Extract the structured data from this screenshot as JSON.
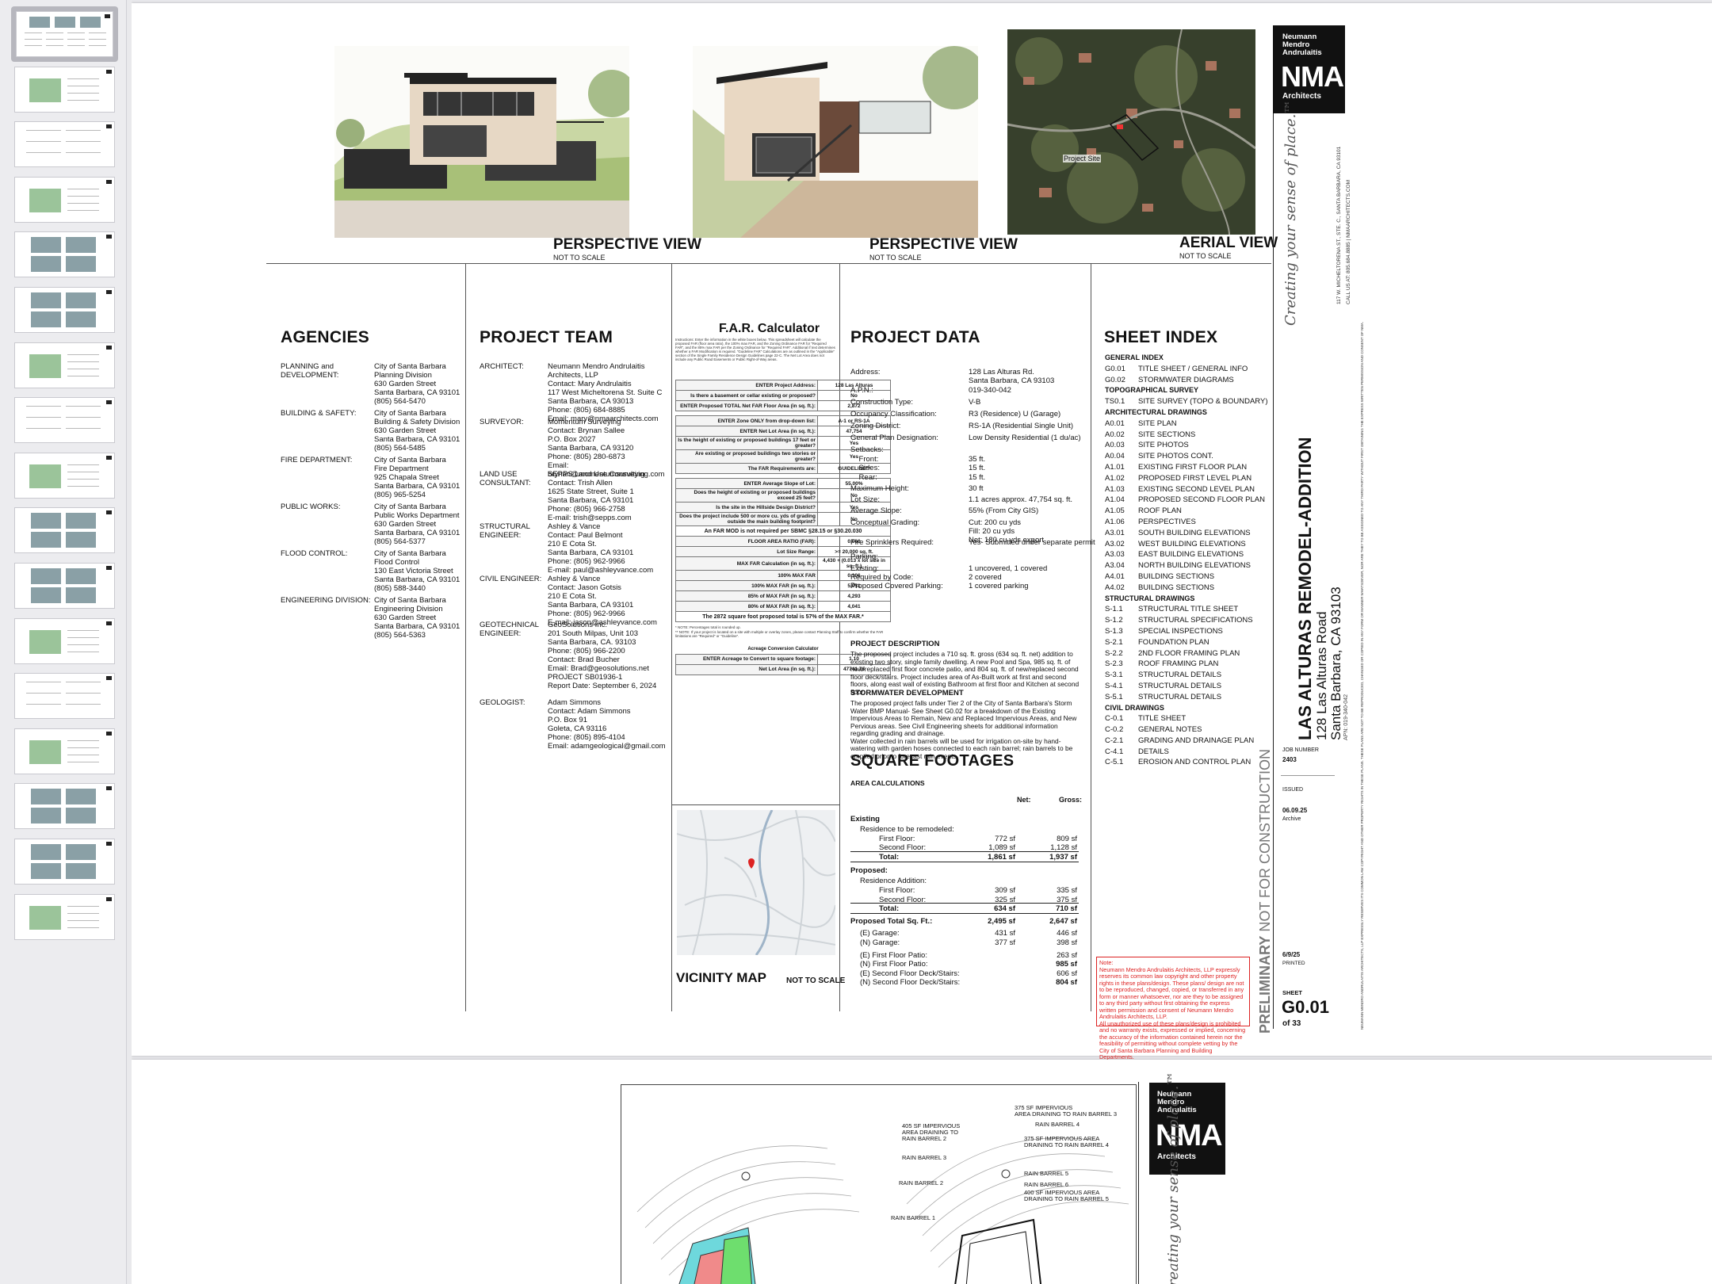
{
  "thumbnails": {
    "count": 17,
    "active_index": 0
  },
  "sheet1": {
    "perspective1": {
      "label": "PERSPECTIVE VIEW",
      "scale": "NOT TO SCALE"
    },
    "perspective2": {
      "label": "PERSPECTIVE VIEW",
      "scale": "NOT TO SCALE"
    },
    "aerial": {
      "label": "AERIAL VIEW",
      "scale": "NOT TO SCALE",
      "site_label": "Project Site"
    },
    "agencies": {
      "title": "AGENCIES",
      "items": [
        {
          "name": "PLANNING and\nDEVELOPMENT:",
          "info": "City of Santa Barbara\nPlanning Division\n630 Garden Street\nSanta Barbara, CA 93101\n(805) 564-5470"
        },
        {
          "name": "BUILDING & SAFETY:",
          "info": "City of Santa Barbara\nBuilding & Safety Division\n630 Garden Street\nSanta Barbara, CA 93101\n(805) 564-5485"
        },
        {
          "name": "FIRE DEPARTMENT:",
          "info": "City of Santa Barbara\nFire Department\n925 Chapala Street\nSanta Barbara, CA 93101\n(805) 965-5254"
        },
        {
          "name": "PUBLIC WORKS:",
          "info": "City of Santa Barbara\nPublic Works Department\n630 Garden Street\nSanta Barbara, CA 93101\n(805) 564-5377"
        },
        {
          "name": "FLOOD CONTROL:",
          "info": "City of Santa Barbara\nFlood Control\n130 East Victoria Street\nSanta Barbara, CA 93101\n(805) 588-3440"
        },
        {
          "name": "ENGINEERING DIVISION:",
          "info": "City of Santa Barbara\nEngineering Division\n630 Garden Street\nSanta Barbara, CA 93101\n(805) 564-5363"
        }
      ]
    },
    "team": {
      "title": "PROJECT TEAM",
      "items": [
        {
          "role": "ARCHITECT:",
          "info": "Neumann Mendro Andrulaitis Architects, LLP\nContact: Mary Andrulaitis\n117 West Micheltorena St. Suite C\nSanta Barbara, CA 93013\nPhone: (805) 684-8885\nEmail: mary@nmaarchitects.com"
        },
        {
          "role": "SURVEYOR:",
          "info": "Momentum Surveying\nContact:  Brynan Sallee\nP.O. Box 2027\nSanta Barbara, CA 93120\nPhone: (805) 280-6873\nEmail:  brynan@momentumsurveying.com"
        },
        {
          "role": "LAND USE\nCONSULTANT:",
          "info": "SEPPS Land Use Consulting\nContact: Trish Allen\n1625 State Street, Suite 1\nSanta Barbara, CA 93101\nPhone: (805) 966-2758\nE-mail: trish@sepps.com"
        },
        {
          "role": "STRUCTURAL\nENGINEER:",
          "info": "Ashley & Vance\nContact: Paul Belmont\n210 E Cota St.\nSanta Barbara, CA 93101\nPhone: (805) 962-9966\nE-mail: paul@ashleyvance.com"
        },
        {
          "role": "CIVIL ENGINEER:",
          "info": "Ashley & Vance\nContact: Jason Gotsis\n210 E Cota St.\nSanta Barbara, CA 93101\nPhone: (805) 962-9966\nE-mail: jason@ashleyvance.com"
        },
        {
          "role": "GEOTECHNICAL\nENGINEER:",
          "info": "GeoSolutions Inc.\n201 South Milpas, Unit 103\nSanta Barbara, CA. 93103\nPhone: (805) 966-2200\nContact: Brad Bucher\nEmail: Brad@geosolutions.net\nPROJECT SB01936-1\nReport Date: September 6, 2024"
        },
        {
          "role": "GEOLOGIST:",
          "info": "Adam Simmons\nContact: Adam Simmons\nP.O. Box 91\nGoleta, CA 93116\nPhone: (805) 895-4104\nEmail: adamgeological@gmail.com"
        }
      ]
    },
    "far": {
      "title": "F.A.R. Calculator",
      "rows": [
        {
          "label": "ENTER Project Address:",
          "value": "128 Las Alturas"
        },
        {
          "label": "Is there a basement or cellar existing or proposed?",
          "value": "No"
        },
        {
          "label": "ENTER Proposed TOTAL Net FAR Floor Area (in sq. ft.):",
          "value": "2,872"
        },
        {
          "label": "",
          "value": ""
        },
        {
          "label": "ENTER Zone ONLY from drop-down list:",
          "value": "A-1 or RS-1A"
        },
        {
          "label": "ENTER Net Lot Area (in sq. ft.):",
          "value": "47,754"
        },
        {
          "label": "Is the height of existing or proposed buildings 17 feet or greater?",
          "value": "Yes"
        },
        {
          "label": "Are existing or proposed buildings two stories or greater?",
          "value": "Yes"
        },
        {
          "label": "The FAR Requirements are:",
          "value": "GUIDELINE**"
        },
        {
          "label": "",
          "value": ""
        },
        {
          "label": "ENTER Average Slope of Lot:",
          "value": "55.00%"
        },
        {
          "label": "Does the height of existing or proposed buildings exceed 25 feet?",
          "value": "No"
        },
        {
          "label": "Is the site in the Hillside Design District?",
          "value": "Yes"
        },
        {
          "label": "Does the project include 500 or more cu. yds of grading outside the main building footprint?",
          "value": "No"
        },
        {
          "label": "An FAR MOD is not required per SBMC §28.15 or §30.20.030",
          "value": ""
        },
        {
          "label": "FLOOR AREA RATIO (FAR):",
          "value": "0.060"
        },
        {
          "label": "Lot Size Range:",
          "value": ">= 20,000 sq. ft."
        },
        {
          "label": "MAX FAR Calculation (in sq. ft.):",
          "value": "4,430 + (0.013 x lot size in sq. ft.)"
        },
        {
          "label": "100% MAX FAR",
          "value": "0.106"
        },
        {
          "label": "100% MAX FAR (in sq. ft.):",
          "value": "5,051"
        },
        {
          "label": "85% of MAX FAR (in sq. ft.):",
          "value": "4,293"
        },
        {
          "label": "80% of MAX FAR (in sq. ft.):",
          "value": "4,041"
        },
        {
          "label": "The 2872 square foot proposed total is 57% of the MAX FAR.*",
          "value": ""
        }
      ],
      "conv_title": "Acreage Conversion Calculator",
      "conv_rows": [
        {
          "label": "ENTER Acreage to Convert to square footage:",
          "value": "1.10"
        },
        {
          "label": "Net Lot Area (in sq. ft.):",
          "value": "47741.76"
        }
      ]
    },
    "vicinity": {
      "label": "VICINITY MAP",
      "scale": "NOT TO  SCALE"
    },
    "project_data": {
      "title": "PROJECT DATA",
      "rows": [
        {
          "label": "Address:",
          "value": "128 Las Alturas Rd.\nSanta Barbara, CA 93103"
        },
        {
          "label": "A.P.N.:",
          "value": "019-340-042"
        },
        {
          "label": "Construction Type:",
          "value": "V-B"
        },
        {
          "label": "Occupancy Classification:",
          "value": "R3 (Residence)  U (Garage)"
        },
        {
          "label": "Zoning District:",
          "value": "RS-1A (Residential Single Unit)"
        },
        {
          "label": "General Plan Designation:",
          "value": "Low Density Residential  (1 du/ac)"
        },
        {
          "label": "Setbacks:",
          "value": ""
        },
        {
          "label": "    Front:",
          "value": "35 ft."
        },
        {
          "label": "    Sides:",
          "value": "15 ft."
        },
        {
          "label": "    Rear:",
          "value": "15 ft."
        },
        {
          "label": "Maximum Height:",
          "value": "30 ft"
        },
        {
          "label": "Lot Size:",
          "value": "1.1 acres  approx. 47,754 sq. ft."
        },
        {
          "label": "Average Slope:",
          "value": "55% (From City GIS)"
        },
        {
          "label": "Conceptual Grading:",
          "value": "Cut: 200 cu yds\nFill: 20 cu yds\nNet: 180 cu yds export"
        },
        {
          "label": "Fire Sprinklers Required:",
          "value": "Yes- Submitted under separate permit"
        },
        {
          "label": "Parking:",
          "value": ""
        },
        {
          "label": "Existing:\nRequired by Code:\nProposed Covered Parking:",
          "value": "1 uncovered, 1 covered\n2 covered\n1 covered parking"
        }
      ],
      "desc_title": "PROJECT DESCRIPTION",
      "desc": "The proposed project includes a 710 sq. ft. gross (634 sq. ft. net) addition to existing two story, single family dwelling.  A new Pool and Spa, 985 sq. ft. of new/replaced first floor concrete patio, and 804 sq. ft. of new/replaced second floor deck/stairs.  Project includes area of As-Built work at first and second floors, along east wall of existing Bathroom at first floor and Kitchen at second floor.",
      "storm_title": "STORMWATER DEVELOPMENT",
      "storm": "The proposed project falls under Tier 2 of the City of Santa Barbara's Storm Water BMP Manual-  See Sheet G0.02 for a breakdown of the Existing Impervious Areas to Remain, New and Replaced Impervious Areas, and New Pervious areas.  See Civil Engineering sheets for additional information regarding grading and drainage.\nWater collected in rain barrels will be used for irrigation on-site by hand-watering with garden hoses connected to each rain barrel; rain barrels to be emptied prior to forecast rain events."
    },
    "square_footages": {
      "title": "SQUARE FOOTAGES",
      "sub": "AREA CALCULATIONS",
      "col_net": "Net:",
      "col_gross": "Gross:",
      "rows": [
        {
          "label": "Existing",
          "net": "",
          "gross": "",
          "bold": true,
          "indent": 0
        },
        {
          "label": "Residence to be remodeled:",
          "net": "",
          "gross": "",
          "indent": 1
        },
        {
          "label": "First Floor:",
          "net": "772 sf",
          "gross": "809 sf",
          "indent": 2
        },
        {
          "label": "Second Floor:",
          "net": "1,089 sf",
          "gross": "1,128 sf",
          "indent": 2
        },
        {
          "label": "Total:",
          "net": "1,861 sf",
          "gross": "1,937 sf",
          "bold": true,
          "indent": 2
        },
        {
          "label": "Proposed:",
          "net": "",
          "gross": "",
          "bold": true,
          "indent": 0
        },
        {
          "label": "Residence Addition:",
          "net": "",
          "gross": "",
          "indent": 1
        },
        {
          "label": "First Floor:",
          "net": "309 sf",
          "gross": "335 sf",
          "indent": 2
        },
        {
          "label": "Second Floor:",
          "net": "325 sf",
          "gross": "375 sf",
          "indent": 2
        },
        {
          "label": "Total:",
          "net": "634 sf",
          "gross": "710 sf",
          "bold": true,
          "indent": 2
        },
        {
          "label": "Proposed Total Sq. Ft.:",
          "net": "2,495 sf",
          "gross": "2,647 sf",
          "bold": true,
          "indent": 0
        },
        {
          "label": "(E) Garage:",
          "net": "431 sf",
          "gross": "446 sf",
          "indent": 1
        },
        {
          "label": "(N) Garage:",
          "net": "377 sf",
          "gross": "398 sf",
          "indent": 1
        },
        {
          "label": "(E) First Floor Patio:",
          "net": "",
          "gross": "263 sf",
          "indent": 1
        },
        {
          "label": "(N) First Floor Patio:",
          "net": "",
          "gross": "985 sf",
          "bold_gross": true,
          "indent": 1
        },
        {
          "label": "(E) Second Floor Deck/Stairs:",
          "net": "",
          "gross": "606 sf",
          "indent": 1
        },
        {
          "label": "(N) Second Floor Deck/Stairs:",
          "net": "",
          "gross": "804 sf",
          "bold_gross": true,
          "indent": 1
        }
      ]
    },
    "sheet_index": {
      "title": "SHEET INDEX",
      "groups": [
        {
          "name": "GENERAL INDEX",
          "items": [
            [
              "G0.01",
              "TITLE SHEET / GENERAL INFO"
            ],
            [
              "G0.02",
              "STORMWATER DIAGRAMS"
            ]
          ]
        },
        {
          "name": "TOPOGRAPHICAL SURVEY",
          "items": [
            [
              "TS0.1",
              "SITE SURVEY (TOPO & BOUNDARY)"
            ]
          ]
        },
        {
          "name": "ARCHITECTURAL DRAWINGS",
          "items": [
            [
              "A0.01",
              "SITE PLAN"
            ],
            [
              "A0.02",
              "SITE SECTIONS"
            ],
            [
              "A0.03",
              "SITE PHOTOS"
            ],
            [
              "A0.04",
              "SITE PHOTOS CONT."
            ],
            [
              "A1.01",
              "EXISTING FIRST FLOOR PLAN"
            ],
            [
              "A1.02",
              "PROPOSED FIRST LEVEL PLAN"
            ],
            [
              "A1.03",
              "EXISTING SECOND LEVEL PLAN"
            ],
            [
              "A1.04",
              "PROPOSED SECOND FLOOR PLAN"
            ],
            [
              "A1.05",
              "ROOF PLAN"
            ],
            [
              "A1.06",
              "PERSPECTIVES"
            ],
            [
              "A3.01",
              "SOUTH BUILDING ELEVATIONS"
            ],
            [
              "A3.02",
              "WEST BUILDING ELEVATIONS"
            ],
            [
              "A3.03",
              "EAST BUILDING ELEVATIONS"
            ],
            [
              "A3.04",
              "NORTH BUILDING ELEVATIONS"
            ],
            [
              "A4.01",
              "BUILDING SECTIONS"
            ],
            [
              "A4.02",
              "BUILDING SECTIONS"
            ]
          ]
        },
        {
          "name": "STRUCTURAL DRAWINGS",
          "items": [
            [
              "S-1.1",
              "STRUCTURAL TITLE SHEET"
            ],
            [
              "S-1.2",
              "STRUCTURAL SPECIFICATIONS"
            ],
            [
              "S-1.3",
              "SPECIAL INSPECTIONS"
            ],
            [
              "S-2.1",
              "FOUNDATION PLAN"
            ],
            [
              "S-2.2",
              "2ND FLOOR FRAMING PLAN"
            ],
            [
              "S-2.3",
              "ROOF FRAMING PLAN"
            ],
            [
              "S-3.1",
              "STRUCTURAL DETAILS"
            ],
            [
              "S-4.1",
              "STRUCTURAL DETAILS"
            ],
            [
              "S-5.1",
              "STRUCTURAL DETAILS"
            ]
          ]
        },
        {
          "name": "CIVIL DRAWINGS",
          "items": [
            [
              "C-0.1",
              "TITLE SHEET"
            ],
            [
              "C-0.2",
              "GENERAL NOTES"
            ],
            [
              "C-2.1",
              "GRADING AND DRAINAGE PLAN"
            ],
            [
              "C-4.1",
              "DETAILS"
            ],
            [
              "C-5.1",
              "EROSION AND CONTROL PLAN"
            ]
          ]
        }
      ],
      "red_note": "Note:\nNeumann Mendro Andrulaitis Architects, LLP expressly reserves its common law copyright and other property rights in these plans/design.  These plans/ design are not to be reproduced, changed, copied, or transferred in any form or manner whatsoever, nor are they to be assigned to any third party without first obtaining the express written permission and consent of Neumann Mendro Andrulaitis Architects, LLP.\nAll unauthorized use of these plans/design is prohibited and no warranty exists, expressed or implied, concerning the accuracy of the information contained herein nor the feasibility of permitting without complete vetting by the City of Santa Barbara Planning and Building Departments."
    },
    "title_block": {
      "firm_small": "Neumann\nMendro\nAndrulaitis",
      "logo": "NMA",
      "architects": "Architects",
      "tagline": "Creating your sense of place.™",
      "address": "117 W. MICHELTORENA ST., STE. C., SANTA BARBARA, CA 93101",
      "phone": "CALL US AT: 805.684.8885 | NMAARCHITECTS.COM",
      "project_title": "LAS ALTURAS REMODEL-ADDITION",
      "project_addr1": "128 Las Alturas Road",
      "project_addr2": "Santa Barbara, CA 93103",
      "apn": "APN: 019-340-042",
      "preliminary_bold": "PRELIMINARY",
      "preliminary_rest": " NOT FOR CONSTRUCTION",
      "job_label": "JOB NUMBER",
      "job": "2403",
      "issued_label": "ISSUED",
      "issued": "06.09.25",
      "issued_sub": "Archive",
      "printed": "6/9/25",
      "printed_label": "PRINTED",
      "sheet_label": "SHEET",
      "sheet": "G0.01",
      "of": "of 33",
      "copyright": "NEUMANN MENDRO ANDRULAITIS ARCHITECTS, LLP EXPRESSLY RESERVES ITS COMMON LAW COPYRIGHT AND OTHER PROPERTY RIGHTS IN THESE PLANS. THESE PLANS ARE NOT TO BE REPRODUCED, CHANGED OR COPIED IN ANY FORM OR MANNER WHATSOEVER, NOR ARE THEY TO BE ASSIGNED TO ANY THIRD PARTY WITHOUT FIRST OBTAINING THE EXPRESS WRITTEN PERMISSION AND CONSENT OF NMA."
    }
  },
  "sheet2": {
    "firm_small": "Neumann\nMendro\nAndrulaitis",
    "logo": "NMA",
    "architects": "Architects",
    "tagline": "Creating your sense of place.™",
    "labels_left": [
      "AREA DRAINING TO RAIN BARREL 2"
    ],
    "labels": [
      "375 SF IMPERVIOUS\nAREA DRAINING TO RAIN BARREL 3",
      "RAIN BARREL 4",
      "405 SF IMPERVIOUS\nAREA DRAINING TO\nRAIN BARREL 2",
      "375 SF IMPERVIOUS AREA\nDRAINING TO RAIN BARREL 4",
      "RAIN BARREL 3",
      "RAIN BARREL 5",
      "RAIN BARREL 2",
      "RAIN BARREL 6",
      "400 SF IMPERVIOUS AREA\nDRAINING TO RAIN BARREL 5",
      "RAIN BARREL 1"
    ]
  }
}
